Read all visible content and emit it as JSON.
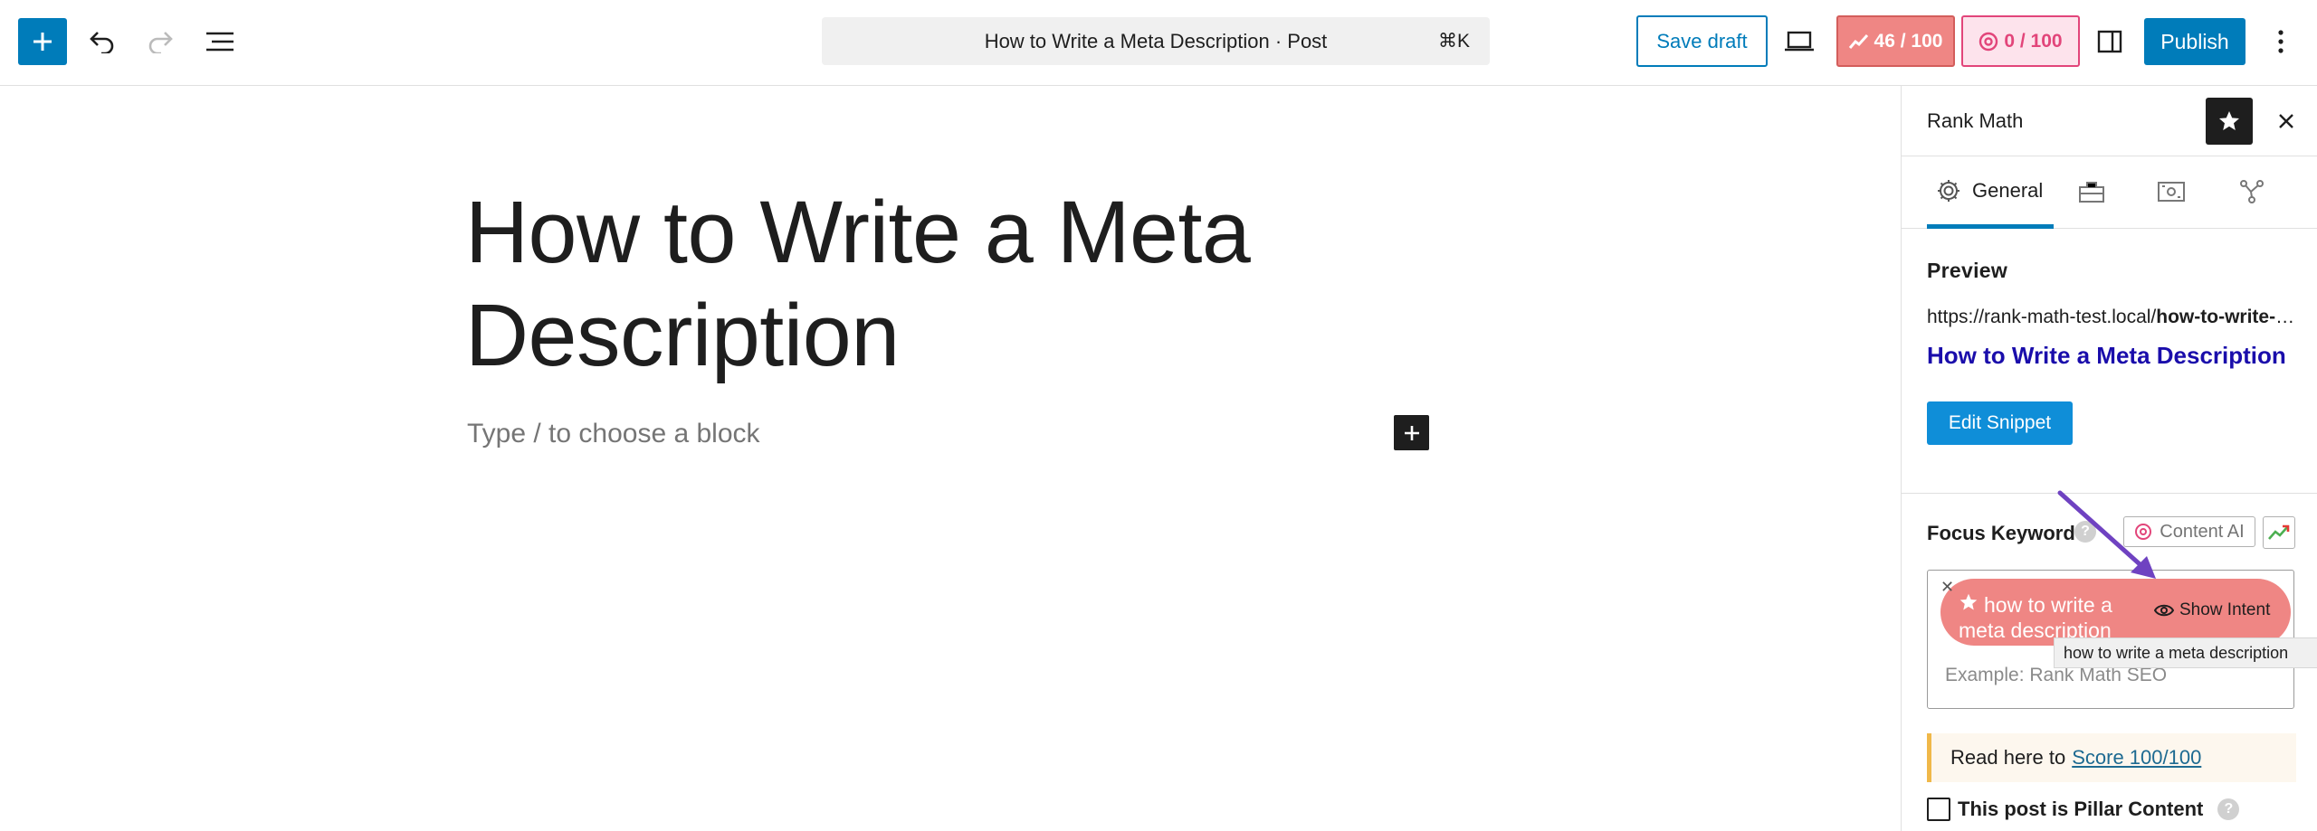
{
  "toolbar": {
    "command_title": "How to Write a Meta Description · Post",
    "command_shortcut": "⌘K",
    "save_draft": "Save draft",
    "seo_score": "46 / 100",
    "ai_score": "0 / 100",
    "publish": "Publish"
  },
  "editor": {
    "title": "How to Write a Meta Description",
    "placeholder": "Type / to choose a block"
  },
  "sidebar": {
    "title": "Rank Math",
    "tabs": {
      "general": "General"
    },
    "preview": {
      "heading": "Preview",
      "url_base": "https://rank-math-test.local/",
      "url_slug": "how-to-write-a-meta-description",
      "link_title": "How to Write a Meta Description"
    },
    "edit_snippet": "Edit Snippet",
    "focus_keyword": {
      "label": "Focus Keyword",
      "help": "?",
      "content_ai": "Content AI",
      "keyword": "how to write a meta description",
      "show_intent": "Show Intent",
      "tooltip": "how to write a meta description",
      "placeholder": "Example: Rank Math SEO"
    },
    "notice": {
      "text": "Read here to",
      "link": "Score 100/100"
    },
    "pillar": {
      "label": "This post is Pillar Content",
      "help": "?"
    }
  },
  "colors": {
    "wp_blue": "#007cba",
    "seo_score_bg": "#ef8684",
    "ai_score_accent": "#e2457a",
    "link_blue": "#1a0dab",
    "arrow_purple": "#6f42c1"
  }
}
